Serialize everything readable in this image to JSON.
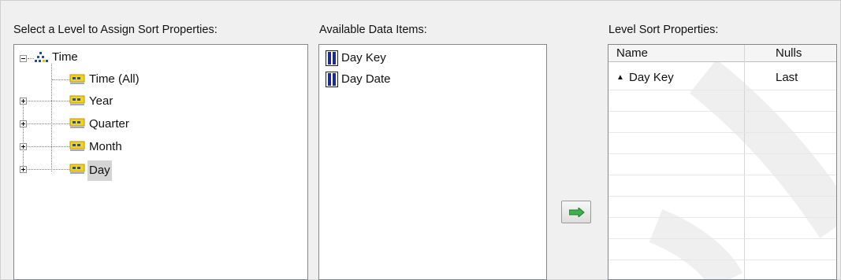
{
  "labels": {
    "levels_title": "Select a Level to Assign Sort Properties:",
    "items_title": "Available Data Items:",
    "sort_title": "Level Sort Properties:"
  },
  "tree": {
    "root": "Time",
    "children": [
      "Time (All)",
      "Year",
      "Quarter",
      "Month",
      "Day"
    ],
    "selected": "Day"
  },
  "data_items": [
    "Day Key",
    "Day Date"
  ],
  "sort_grid": {
    "columns": [
      "Name",
      "Nulls"
    ],
    "rows": [
      {
        "name": "Day Key",
        "nulls": "Last",
        "direction": "ascending"
      }
    ]
  },
  "icons": {
    "tree_root": "hierarchy-icon",
    "tree_level": "level-icon",
    "data_item": "data-item-icon",
    "add_button": "green-right-arrow-icon",
    "sort": "sort-ascending-icon"
  },
  "colors": {
    "selection": "#d4d4d4",
    "arrow": "#3cb34a",
    "level_icon": "#e6c200"
  }
}
